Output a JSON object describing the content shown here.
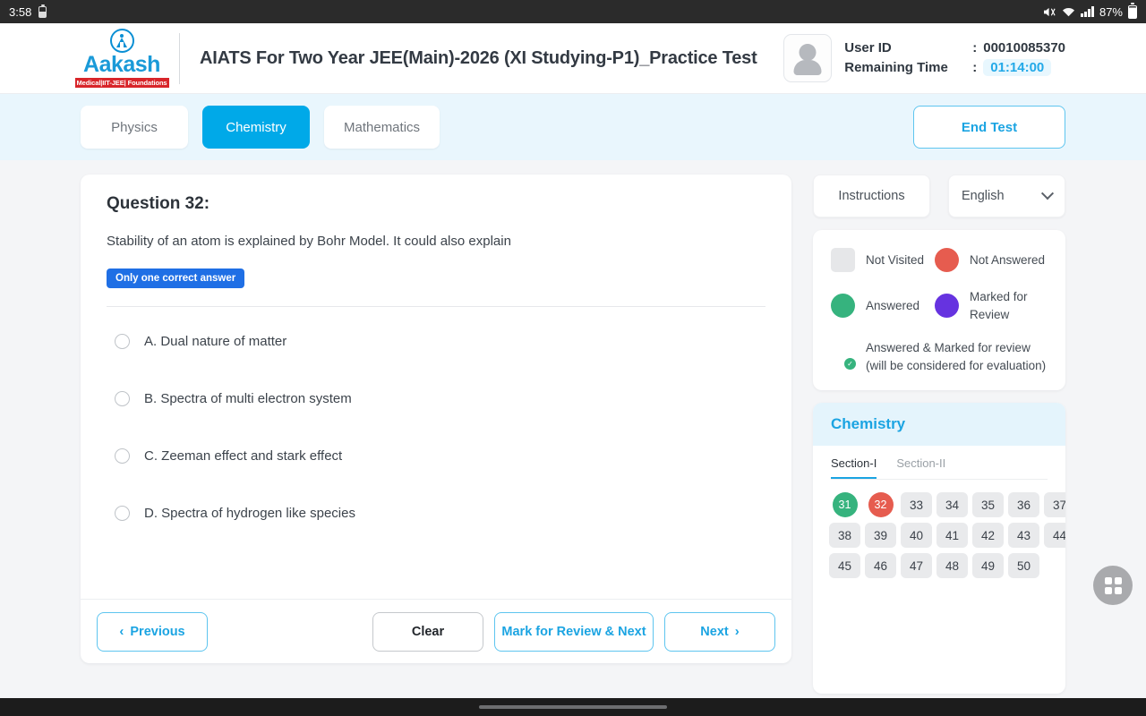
{
  "status_bar": {
    "time": "3:58",
    "battery_percent": "87%",
    "icons": [
      "battery-saver-icon",
      "mute-icon",
      "wifi-icon",
      "signal-icon",
      "battery-icon"
    ]
  },
  "header": {
    "logo": {
      "word": "Aakash",
      "tagline": "Medical|IIT-JEE| Foundations"
    },
    "title": "AIATS For Two Year JEE(Main)-2026 (XI Studying-P1)_Practice Test",
    "user_id_label": "User ID",
    "user_id_value": "00010085370",
    "remaining_time_label": "Remaining Time",
    "remaining_time_value": "01:14:00",
    "colon": ":"
  },
  "subject_tabs": [
    {
      "label": "Physics",
      "active": false
    },
    {
      "label": "Chemistry",
      "active": true
    },
    {
      "label": "Mathematics",
      "active": false
    }
  ],
  "end_test_label": "End Test",
  "question": {
    "number_label": "Question 32:",
    "text": "Stability of an atom is explained by Bohr Model. It could also explain",
    "badge": "Only one correct answer",
    "options": [
      {
        "label": "A. Dual nature of matter",
        "selected": false
      },
      {
        "label": "B. Spectra of multi electron system",
        "selected": false
      },
      {
        "label": "C. Zeeman effect and stark effect",
        "selected": false
      },
      {
        "label": "D. Spectra of hydrogen like species",
        "selected": false
      }
    ]
  },
  "actions": {
    "previous": "Previous",
    "clear": "Clear",
    "mark_review_next": "Mark for Review & Next",
    "next": "Next"
  },
  "sidebar": {
    "instructions_label": "Instructions",
    "language_value": "English",
    "legend": [
      {
        "key": "not_visited",
        "label": "Not Visited",
        "color": "#e6e7e9",
        "shape": "square"
      },
      {
        "key": "not_answered",
        "label": "Not Answered",
        "color": "#e65c4f",
        "shape": "circle"
      },
      {
        "key": "answered",
        "label": "Answered",
        "color": "#36b37e",
        "shape": "circle"
      },
      {
        "key": "marked_for_review",
        "label": "Marked for Review",
        "color": "#6633e0",
        "shape": "circle"
      }
    ],
    "legend_combo": {
      "label": "Answered & Marked for review (will be considered for evaluation)",
      "color": "#6633e0",
      "badge_color": "#36b37e"
    },
    "palette": {
      "subject": "Chemistry",
      "sections": [
        {
          "label": "Section-I",
          "active": true
        },
        {
          "label": "Section-II",
          "active": false
        }
      ],
      "questions": [
        {
          "n": "31",
          "state": "answered"
        },
        {
          "n": "32",
          "state": "notanswered"
        },
        {
          "n": "33",
          "state": "notvisited"
        },
        {
          "n": "34",
          "state": "notvisited"
        },
        {
          "n": "35",
          "state": "notvisited"
        },
        {
          "n": "36",
          "state": "notvisited"
        },
        {
          "n": "37",
          "state": "notvisited"
        },
        {
          "n": "38",
          "state": "notvisited"
        },
        {
          "n": "39",
          "state": "notvisited"
        },
        {
          "n": "40",
          "state": "notvisited"
        },
        {
          "n": "41",
          "state": "notvisited"
        },
        {
          "n": "42",
          "state": "notvisited"
        },
        {
          "n": "43",
          "state": "notvisited"
        },
        {
          "n": "44",
          "state": "notvisited"
        },
        {
          "n": "45",
          "state": "notvisited"
        },
        {
          "n": "46",
          "state": "notvisited"
        },
        {
          "n": "47",
          "state": "notvisited"
        },
        {
          "n": "48",
          "state": "notvisited"
        },
        {
          "n": "49",
          "state": "notvisited"
        },
        {
          "n": "50",
          "state": "notvisited"
        }
      ]
    }
  },
  "fab": {
    "icon": "apps-grid-icon"
  },
  "colors": {
    "accent_blue": "#00a9e8",
    "link_blue": "#1ba4e2",
    "badge_blue": "#1f6fe5",
    "green": "#36b37e",
    "red": "#e65c4f",
    "purple": "#6633e0",
    "page_bg": "#f4f5f7"
  }
}
